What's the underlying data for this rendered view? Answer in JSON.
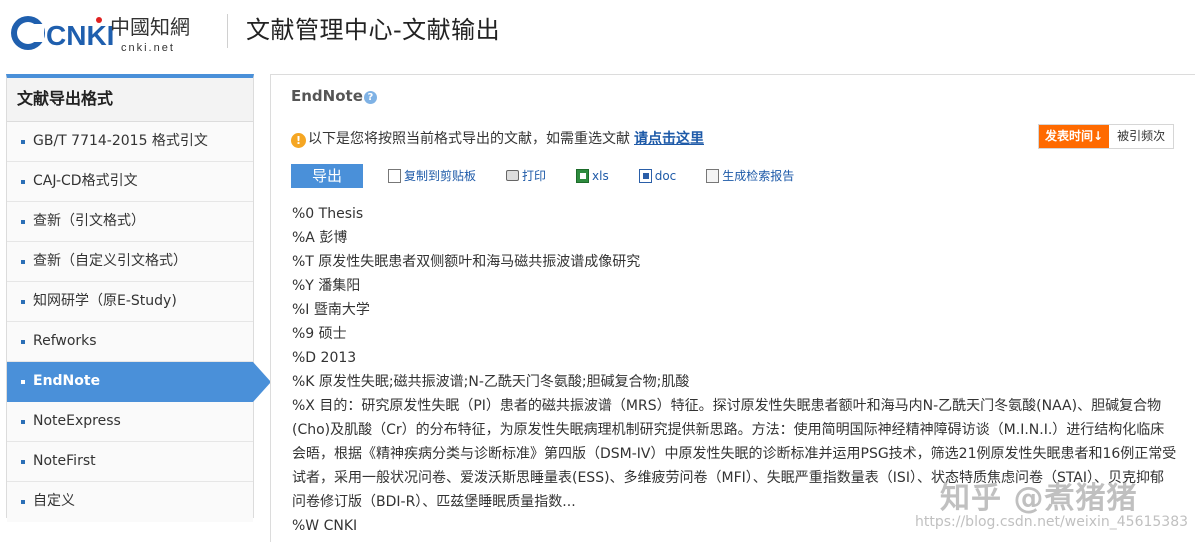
{
  "header": {
    "logo_cnki": "CNKI",
    "logo_cn": "中國知網",
    "logo_url": "cnki.net",
    "title": "文献管理中心-文献输出"
  },
  "sidebar": {
    "title": "文献导出格式",
    "items": [
      {
        "label": "GB/T 7714-2015 格式引文",
        "active": false
      },
      {
        "label": "CAJ-CD格式引文",
        "active": false
      },
      {
        "label": "查新（引文格式）",
        "active": false
      },
      {
        "label": "查新（自定义引文格式）",
        "active": false
      },
      {
        "label": "知网研学（原E-Study)",
        "active": false
      },
      {
        "label": "Refworks",
        "active": false
      },
      {
        "label": "EndNote",
        "active": true
      },
      {
        "label": "NoteExpress",
        "active": false
      },
      {
        "label": "NoteFirst",
        "active": false
      },
      {
        "label": "自定义",
        "active": false
      }
    ]
  },
  "main": {
    "title": "EndNote",
    "help_icon": "?",
    "notice_text": "以下是您将按照当前格式导出的文献，如需重选文献",
    "notice_link": "请点击这里",
    "sort": {
      "published_label": "发表时间↓",
      "cited_label": "被引频次"
    },
    "toolbar": {
      "export_label": "导出",
      "copy_label": "复制到剪贴板",
      "print_label": "打印",
      "xls_label": "xls",
      "doc_label": "doc",
      "report_label": "生成检索报告"
    },
    "record": [
      "%0 Thesis",
      "%A 彭博",
      "%T 原发性失眠患者双侧额叶和海马磁共振波谱成像研究",
      "%Y 潘集阳",
      "%I 暨南大学",
      "%9 硕士",
      "%D 2013",
      "%K 原发性失眠;磁共振波谱;N-乙酰天门冬氨酸;胆碱复合物;肌酸",
      "%X 目的：研究原发性失眠（PI）患者的磁共振波谱（MRS）特征。探讨原发性失眠患者额叶和海马内N-乙酰天门冬氨酸(NAA)、胆碱复合物(Cho)及肌酸（Cr）的分布特征，为原发性失眠病理机制研究提供新思路。方法：使用简明国际神经精神障碍访谈（M.I.N.I.）进行结构化临床会晤，根据《精神疾病分类与诊断标准》第四版（DSM-IV）中原发性失眠的诊断标准并运用PSG技术，筛选21例原发性失眠患者和16例正常受试者，采用一般状况问卷、爱泼沃斯思睡量表(ESS)、多维疲劳问卷（MFI）、失眠严重指数量表（ISI）、状态特质焦虑问卷（STAI）、贝克抑郁问卷修订版（BDI-R）、匹兹堡睡眠质量指数...",
      "%W CNKI"
    ]
  },
  "watermark": {
    "brand": "知乎 @煮猪猪",
    "url": "https://blog.csdn.net/weixin_45615383"
  },
  "colors": {
    "accent": "#4a90d9",
    "sort_active": "#ff6a00",
    "link": "#1e5aa8",
    "warn": "#f5a623"
  }
}
